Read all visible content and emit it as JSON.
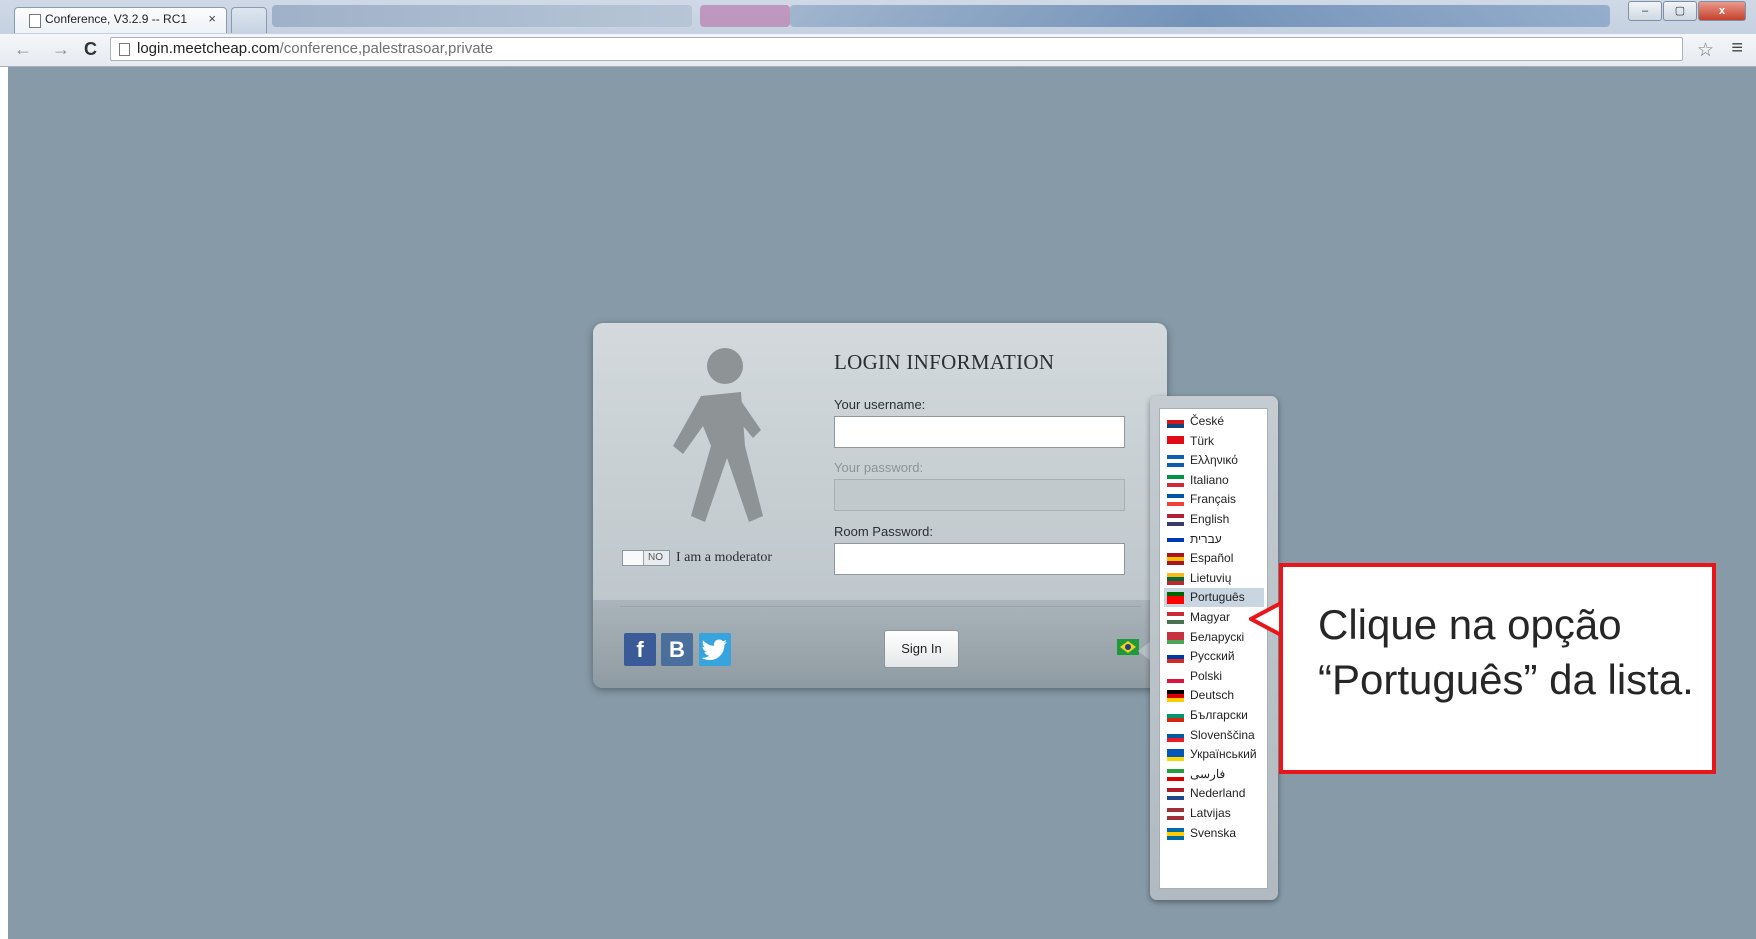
{
  "browser": {
    "tab_title": "Conference, V3.2.9 -- RC1",
    "tab_close": "×",
    "url_host": "login.meetcheap.com",
    "url_path": "/conference,palestrasoar,private",
    "back": "←",
    "forward": "→",
    "reload": "C",
    "star": "☆",
    "menu": "≡",
    "win_min": "–",
    "win_max": "▢",
    "win_close": "x"
  },
  "login": {
    "title": "LOGIN INFORMATION",
    "username_label": "Your username:",
    "username_value": "",
    "password_label": "Your password:",
    "room_password_label": "Room Password:",
    "room_password_value": "",
    "moderator_switch": "NO",
    "moderator_label": "I am a moderator",
    "sign_in": "Sign In",
    "social": {
      "facebook": "f",
      "vk": "B",
      "twitter": "t"
    },
    "current_language_icon": "brazil-flag-icon"
  },
  "languages": [
    {
      "name": "České",
      "flag": [
        "#ffffff",
        "#d7141a",
        "#11457e"
      ]
    },
    {
      "name": "Türk",
      "flag": [
        "#e30a17",
        "#e30a17",
        "#ffffff"
      ]
    },
    {
      "name": "Ελληνικό",
      "flag": [
        "#0d5eaf",
        "#ffffff",
        "#0d5eaf"
      ]
    },
    {
      "name": "Italiano",
      "flag": [
        "#009246",
        "#ffffff",
        "#ce2b37"
      ]
    },
    {
      "name": "Français",
      "flag": [
        "#0055a4",
        "#ffffff",
        "#ef4135"
      ]
    },
    {
      "name": "English",
      "flag": [
        "#b22234",
        "#ffffff",
        "#3c3b6e"
      ]
    },
    {
      "name": "עברית",
      "flag": [
        "#ffffff",
        "#0038b8",
        "#ffffff"
      ]
    },
    {
      "name": "Español",
      "flag": [
        "#aa151b",
        "#f1bf00",
        "#aa151b"
      ]
    },
    {
      "name": "Lietuvių",
      "flag": [
        "#fdb913",
        "#006a44",
        "#c1272d"
      ]
    },
    {
      "name": "Português",
      "flag": [
        "#006600",
        "#ff0000",
        "#ff0000"
      ],
      "selected": true
    },
    {
      "name": "Magyar",
      "flag": [
        "#ce2939",
        "#ffffff",
        "#477050"
      ]
    },
    {
      "name": "Беларускі",
      "flag": [
        "#c8313e",
        "#c8313e",
        "#4aa657"
      ]
    },
    {
      "name": "Русский",
      "flag": [
        "#ffffff",
        "#0039a6",
        "#d52b1e"
      ]
    },
    {
      "name": "Polski",
      "flag": [
        "#ffffff",
        "#ffffff",
        "#dc143c"
      ]
    },
    {
      "name": "Deutsch",
      "flag": [
        "#000000",
        "#dd0000",
        "#ffce00"
      ]
    },
    {
      "name": "Български",
      "flag": [
        "#ffffff",
        "#00966e",
        "#d62612"
      ]
    },
    {
      "name": "Slovenščina",
      "flag": [
        "#ffffff",
        "#005da4",
        "#ed1c24"
      ]
    },
    {
      "name": "Український",
      "flag": [
        "#0057b7",
        "#0057b7",
        "#ffd700"
      ]
    },
    {
      "name": "فارسی",
      "flag": [
        "#239f40",
        "#ffffff",
        "#da0000"
      ]
    },
    {
      "name": "Nederland",
      "flag": [
        "#ae1c28",
        "#ffffff",
        "#21468b"
      ]
    },
    {
      "name": "Latvijas",
      "flag": [
        "#9e3039",
        "#ffffff",
        "#9e3039"
      ]
    },
    {
      "name": "Svenska",
      "flag": [
        "#006aa7",
        "#fecc00",
        "#006aa7"
      ]
    }
  ],
  "callout": {
    "text": "Clique na opção “Português” da lista."
  },
  "colors": {
    "page_bg": "#869aa7",
    "callout_border": "#e8151b"
  }
}
